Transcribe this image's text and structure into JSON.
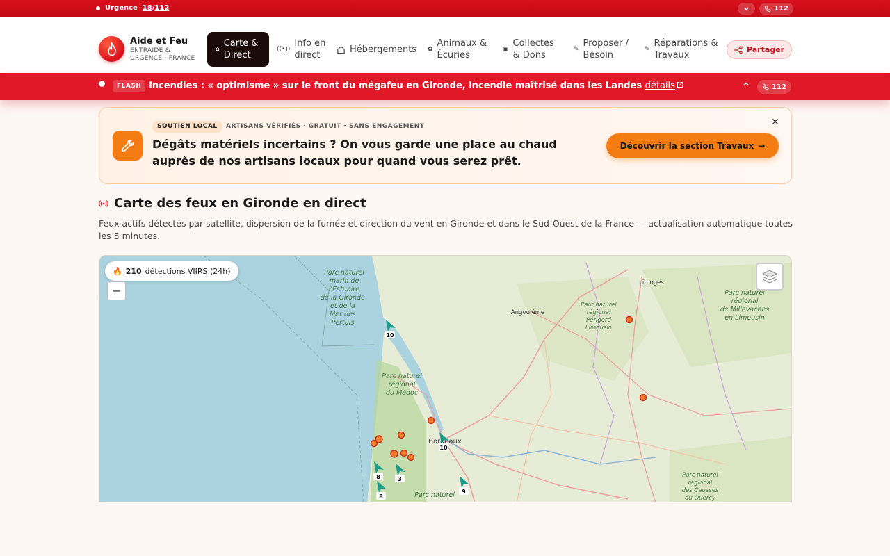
{
  "topbar": {
    "urgence_label": "Urgence",
    "num_18": "18",
    "sep": "/",
    "num_112": "112",
    "phone": "112"
  },
  "brand": {
    "title": "Aide et Feu",
    "subtitle_1": "ENTRAIDE &",
    "subtitle_2": "URGENCE · FRANCE"
  },
  "nav": [
    {
      "line1": "Carte &",
      "line2": "Direct",
      "icon": "map-pin-icon"
    },
    {
      "line1": "Info en",
      "line2": "direct",
      "icon": "radio-icon"
    },
    {
      "line1": "Hébergements",
      "line2": "",
      "icon": "home-icon"
    },
    {
      "line1": "Animaux &",
      "line2": "Écuries",
      "icon": "paw-icon"
    },
    {
      "line1": "Collectes",
      "line2": "& Dons",
      "icon": "box-icon"
    },
    {
      "line1": "Proposer /",
      "line2": "Besoin",
      "icon": "handshake-icon"
    },
    {
      "line1": "Réparations &",
      "line2": "Travaux",
      "icon": "wrench-icon"
    }
  ],
  "share": "Partager",
  "flash": {
    "tag": "FLASH",
    "message": "Incendies : « optimisme » sur le front du mégafeu en Gironde, incendie maîtrisé dans les Landes",
    "details": "détails",
    "phone": "112"
  },
  "promo": {
    "badge": "SOUTIEN LOCAL",
    "meta": "ARTISANS VÉRIFIÉS · GRATUIT · SANS ENGAGEMENT",
    "headline": "Dégâts matériels incertains ? On vous garde une place au chaud auprès de nos artisans locaux pour quand vous serez prêt.",
    "cta": "Découvrir la section Travaux"
  },
  "section": {
    "title": "Carte des feux en Gironde en direct",
    "description": "Feux actifs détectés par satellite, dispersion de la fumée et direction du vent en Gironde et dans le Sud-Ouest de la France — actualisation automatique toutes les 5 minutes."
  },
  "map": {
    "detections_count": "210",
    "detections_label": "détections VIIRS (24h)",
    "zoom_out": "−",
    "labels": {
      "estuaire": [
        "Parc naturel",
        "marin de",
        "l'Estuaire",
        "de la Gironde",
        "et de la",
        "Mer des",
        "Pertuis"
      ],
      "medoc": [
        "Parc naturel",
        "régional",
        "du Médoc"
      ],
      "perigord": [
        "Parc naturel",
        "régional",
        "Périgord",
        "Limousin"
      ],
      "millevaches": [
        "Parc naturel",
        "régional",
        "de Millevaches",
        "en Limousin"
      ],
      "causses": [
        "Parc naturel",
        "régional",
        "des Causses",
        "du Quercy"
      ],
      "landes": [
        "Parc naturel"
      ],
      "angouleme": "Angoulême",
      "limoges": "Limoges",
      "bordeaux": "Bordeaux"
    },
    "wind_values": [
      "10",
      "10",
      "8",
      "8",
      "3",
      "9"
    ]
  }
}
